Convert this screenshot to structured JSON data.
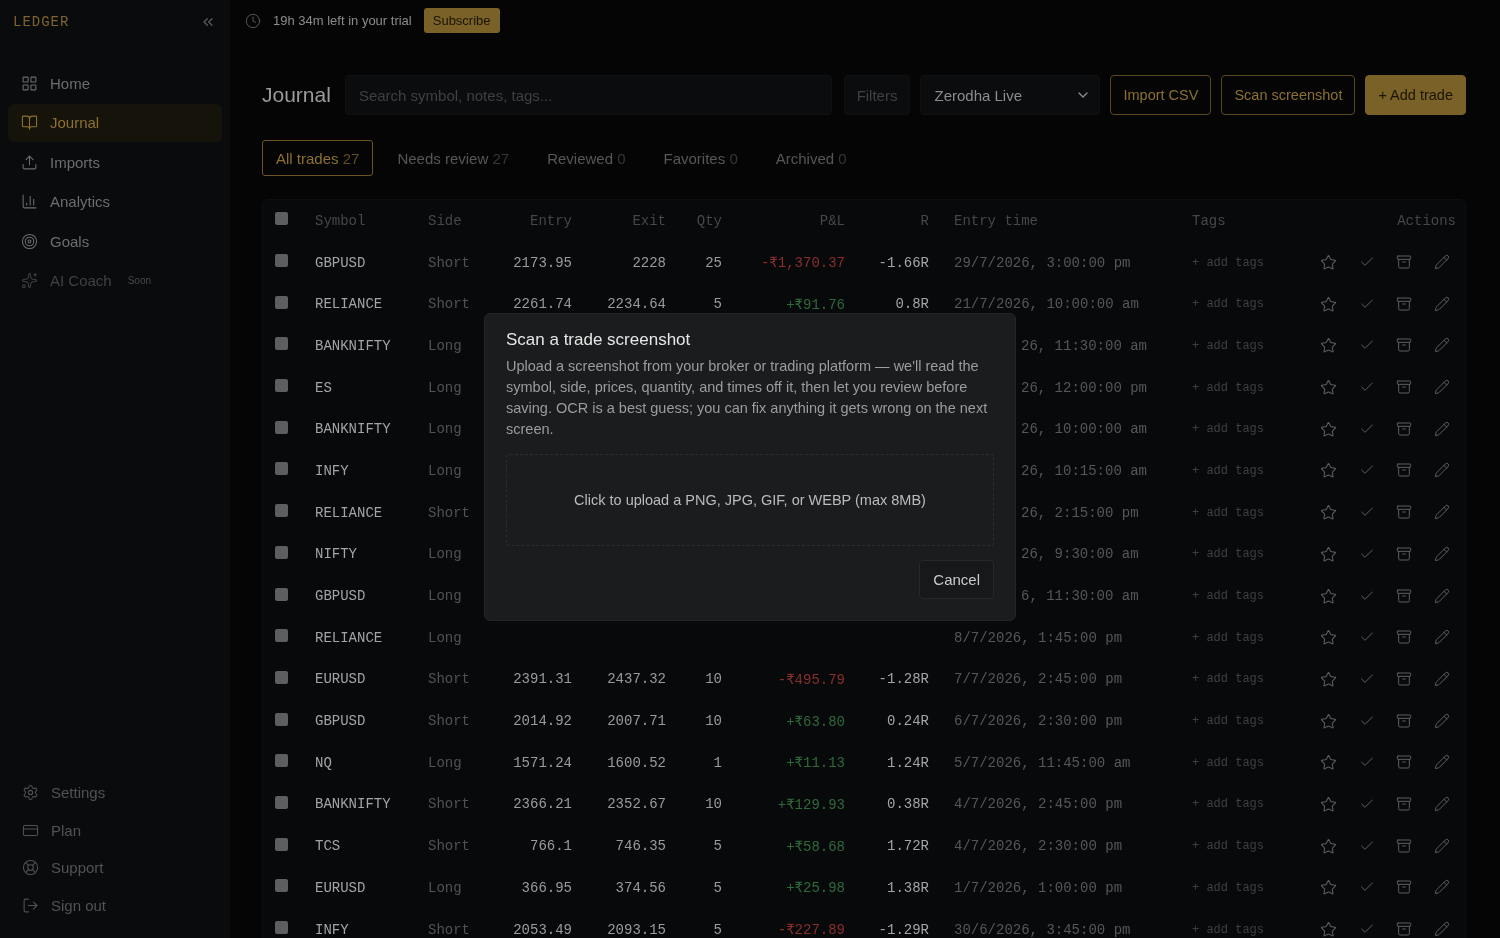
{
  "brand": "LEDGER",
  "sidebar": {
    "items": [
      {
        "label": "Home",
        "selected": false,
        "disabled": false
      },
      {
        "label": "Journal",
        "selected": true,
        "disabled": false
      },
      {
        "label": "Imports",
        "selected": false,
        "disabled": false
      },
      {
        "label": "Analytics",
        "selected": false,
        "disabled": false
      },
      {
        "label": "Goals",
        "selected": false,
        "disabled": false
      },
      {
        "label": "AI Coach",
        "selected": false,
        "disabled": true,
        "badge": "Soon"
      }
    ],
    "footer_items": [
      {
        "label": "Settings"
      },
      {
        "label": "Plan"
      },
      {
        "label": "Support"
      },
      {
        "label": "Sign out"
      }
    ]
  },
  "trial_bar": {
    "text": "19h 34m left in your trial",
    "button": "Subscribe"
  },
  "page_title": "Journal",
  "search": {
    "placeholder": "Search symbol, notes, tags..."
  },
  "filters_button": "Filters",
  "account_select": {
    "value": "Zerodha Live"
  },
  "buttons": [
    {
      "label": "Import CSV",
      "kind": "outline"
    },
    {
      "label": "Scan screenshot",
      "kind": "outline"
    },
    {
      "label": "+ Add trade",
      "kind": "primary"
    }
  ],
  "tabs": [
    {
      "label": "All trades",
      "count": "27",
      "selected": true
    },
    {
      "label": "Needs review",
      "count": "27",
      "selected": false
    },
    {
      "label": "Reviewed",
      "count": "0",
      "selected": false
    },
    {
      "label": "Favorites",
      "count": "0",
      "selected": false
    },
    {
      "label": "Archived",
      "count": "0",
      "selected": false
    }
  ],
  "table": {
    "select_all_checked": false,
    "columns": [
      "Symbol",
      "Side",
      "Entry",
      "Exit",
      "Qty",
      "P&L",
      "R",
      "Entry time",
      "Tags",
      "Actions"
    ],
    "rows": [
      {
        "checked": false,
        "symbol": "GBPUSD",
        "side": "Short",
        "entry": "2173.95",
        "exit": "2228",
        "qty": "25",
        "pnl": "-₹1,370.37",
        "color": "#8a2e2e",
        "r": "-1.66R",
        "entry_time": "29/7/2026, 3:00:00 pm",
        "tags": "+ add tags"
      },
      {
        "checked": false,
        "symbol": "RELIANCE",
        "side": "Short",
        "entry": "2261.74",
        "exit": "2234.64",
        "qty": "5",
        "pnl": "+₹91.76",
        "color": "#2f6a3b",
        "r": "0.8R",
        "entry_time": "21/7/2026, 10:00:00 am",
        "tags": "+ add tags"
      },
      {
        "checked": false,
        "symbol": "BANKNIFTY",
        "side": "Long",
        "entry_time_tail": "26, 11:30:00 am",
        "tags": "+ add tags"
      },
      {
        "checked": false,
        "symbol": "ES",
        "side": "Long",
        "entry_time_tail": "26, 12:00:00 pm",
        "tags": "+ add tags"
      },
      {
        "checked": false,
        "symbol": "BANKNIFTY",
        "side": "Long",
        "entry_time_tail": "26, 10:00:00 am",
        "tags": "+ add tags"
      },
      {
        "checked": false,
        "symbol": "INFY",
        "side": "Long",
        "entry_time_tail": "26, 10:15:00 am",
        "tags": "+ add tags"
      },
      {
        "checked": false,
        "symbol": "RELIANCE",
        "side": "Short",
        "entry_time_tail": "26, 2:15:00 pm",
        "tags": "+ add tags"
      },
      {
        "checked": false,
        "symbol": "NIFTY",
        "side": "Long",
        "entry_time_tail": "26, 9:30:00 am",
        "tags": "+ add tags"
      },
      {
        "checked": false,
        "symbol": "GBPUSD",
        "side": "Long",
        "entry_time_tail": "6, 11:30:00 am",
        "tags": "+ add tags"
      },
      {
        "checked": false,
        "symbol": "RELIANCE",
        "side": "Long",
        "entry_time": "8/7/2026, 1:45:00 pm",
        "tags": "+ add tags"
      },
      {
        "checked": false,
        "symbol": "EURUSD",
        "side": "Short",
        "entry": "2391.31",
        "exit": "2437.32",
        "qty": "10",
        "pnl": "-₹495.79",
        "color": "#8a2e2e",
        "r": "-1.28R",
        "entry_time": "7/7/2026, 2:45:00 pm",
        "tags": "+ add tags"
      },
      {
        "checked": false,
        "symbol": "GBPUSD",
        "side": "Short",
        "entry": "2014.92",
        "exit": "2007.71",
        "qty": "10",
        "pnl": "+₹63.80",
        "color": "#2f6a3b",
        "r": "0.24R",
        "entry_time": "6/7/2026, 2:30:00 pm",
        "tags": "+ add tags"
      },
      {
        "checked": false,
        "symbol": "NQ",
        "side": "Long",
        "entry": "1571.24",
        "exit": "1600.52",
        "qty": "1",
        "pnl": "+₹11.13",
        "color": "#2f6a3b",
        "r": "1.24R",
        "entry_time": "5/7/2026, 11:45:00 am",
        "tags": "+ add tags"
      },
      {
        "checked": false,
        "symbol": "BANKNIFTY",
        "side": "Short",
        "entry": "2366.21",
        "exit": "2352.67",
        "qty": "10",
        "pnl": "+₹129.93",
        "color": "#2f6a3b",
        "r": "0.38R",
        "entry_time": "4/7/2026, 2:45:00 pm",
        "tags": "+ add tags"
      },
      {
        "checked": false,
        "symbol": "TCS",
        "side": "Short",
        "entry": "766.1",
        "exit": "746.35",
        "qty": "5",
        "pnl": "+₹58.68",
        "color": "#2f6a3b",
        "r": "1.72R",
        "entry_time": "4/7/2026, 2:30:00 pm",
        "tags": "+ add tags"
      },
      {
        "checked": false,
        "symbol": "EURUSD",
        "side": "Long",
        "entry": "366.95",
        "exit": "374.56",
        "qty": "5",
        "pnl": "+₹25.98",
        "color": "#2f6a3b",
        "r": "1.38R",
        "entry_time": "1/7/2026, 1:00:00 pm",
        "tags": "+ add tags"
      },
      {
        "checked": false,
        "symbol": "INFY",
        "side": "Short",
        "entry": "2053.49",
        "exit": "2093.15",
        "qty": "5",
        "pnl": "-₹227.89",
        "color": "#8a2e2e",
        "r": "-1.29R",
        "entry_time": "30/6/2026, 3:45:00 pm",
        "tags": "+ add tags"
      }
    ]
  },
  "modal": {
    "title": "Scan a trade screenshot",
    "description": "Upload a screenshot from your broker or trading platform — we'll read the symbol, side, prices, quantity, and times off it, then let you review before saving. OCR is a best guess; you can fix anything it gets wrong on the next screen.",
    "dropzone": "Click to upload a PNG, JPG, GIF, or WEBP (max 8MB)",
    "cancel": "Cancel"
  }
}
